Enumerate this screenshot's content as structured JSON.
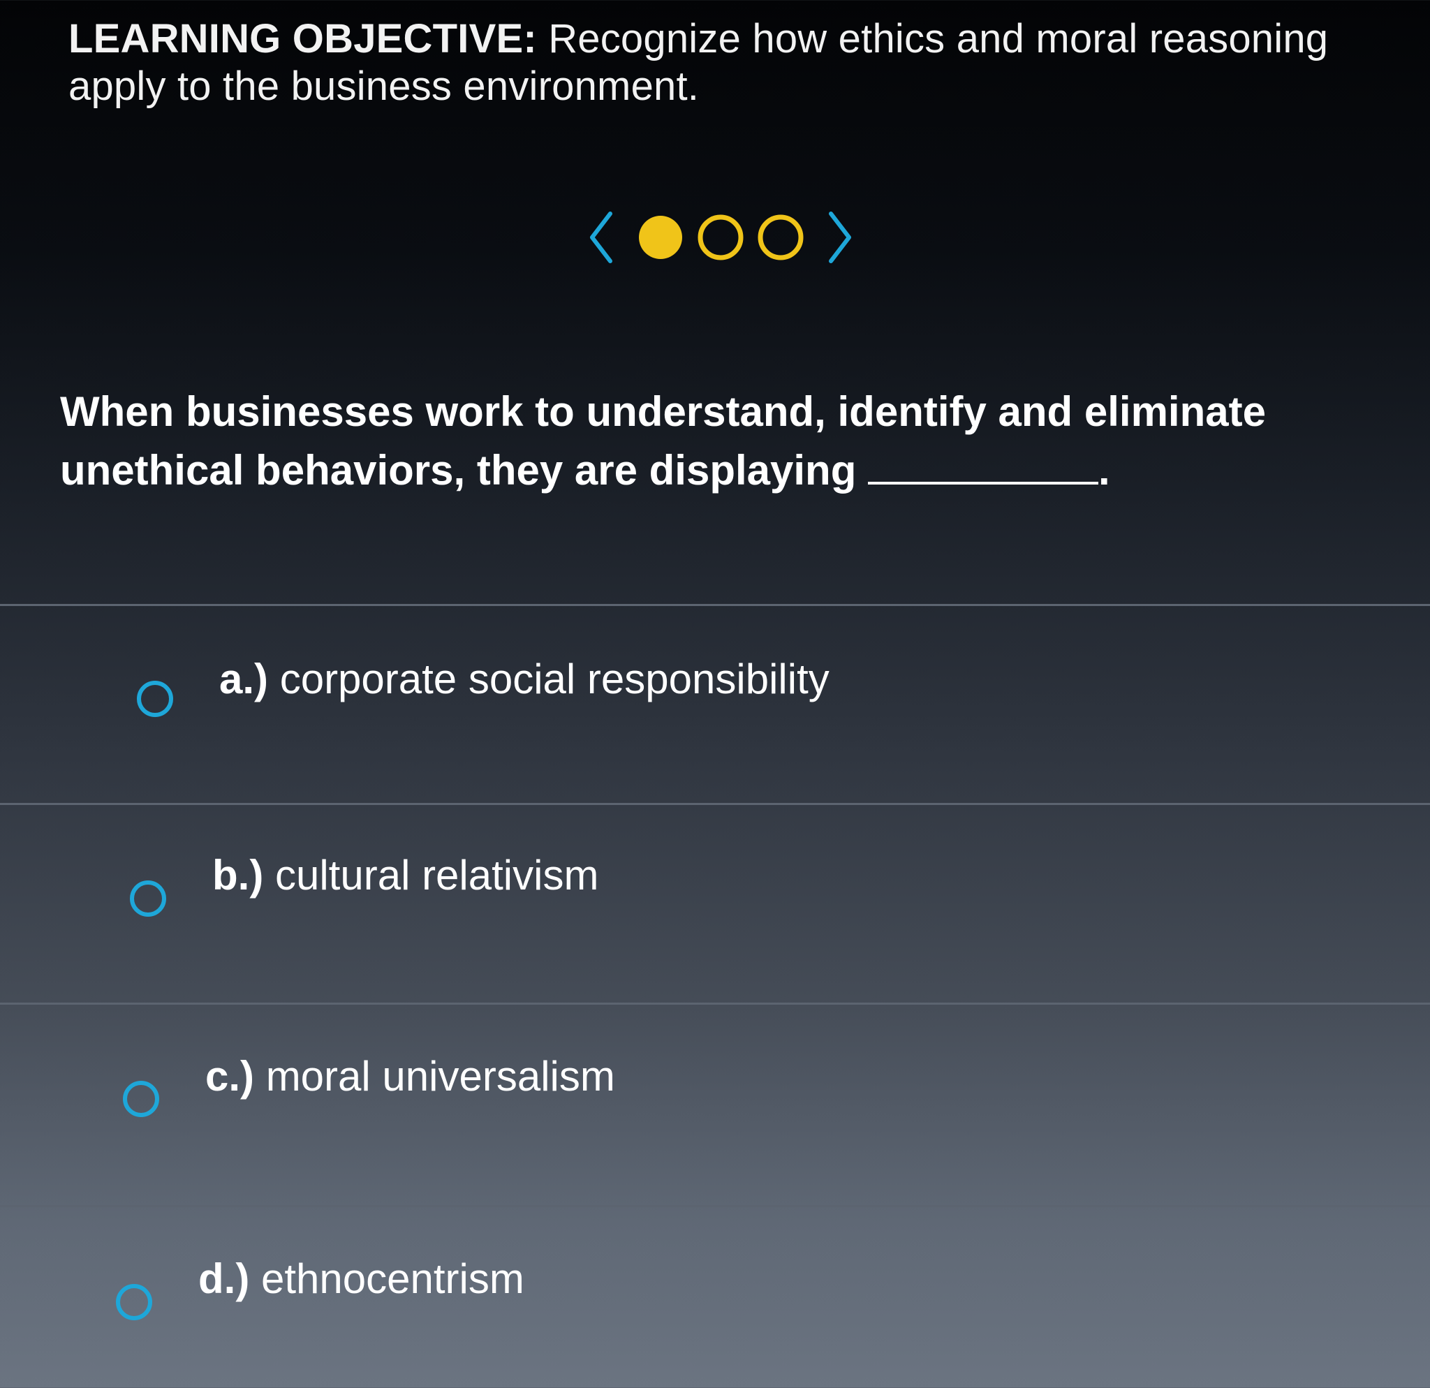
{
  "objective": {
    "label": "LEARNING OBJECTIVE:",
    "text": "Recognize how ethics and moral reasoning apply to the business environment."
  },
  "pager": {
    "total": 3,
    "current": 1,
    "accent": "#f0c419",
    "nav_color": "#1ea7d9"
  },
  "question": {
    "text": "When businesses work to understand, identify and eliminate unethical behaviors, they are displaying",
    "suffix": "."
  },
  "options": [
    {
      "letter": "a.)",
      "text": "corporate social responsibility"
    },
    {
      "letter": "b.)",
      "text": "cultural relativism"
    },
    {
      "letter": "c.)",
      "text": "moral universalism"
    },
    {
      "letter": "d.)",
      "text": "ethnocentrism"
    }
  ]
}
